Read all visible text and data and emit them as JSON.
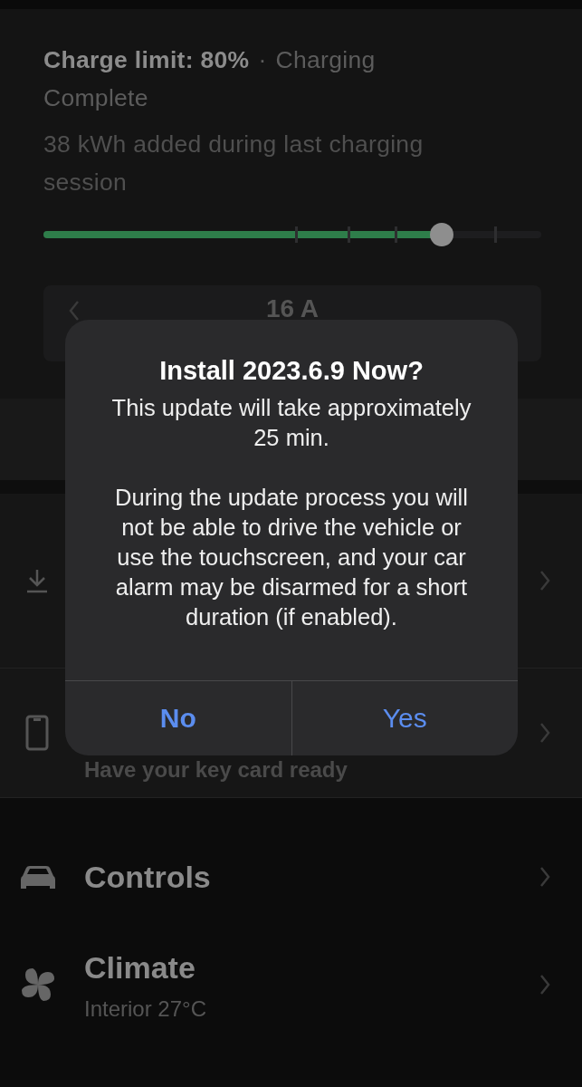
{
  "charge": {
    "limit": "Charge limit: 80%",
    "separator": "·",
    "status": "Charging Complete",
    "added": "38 kWh added during last charging session",
    "level": 0.8
  },
  "amperage": {
    "value": "16 A"
  },
  "rows": [
    {
      "kind": "download"
    },
    {
      "kind": "phone",
      "subtitle": "Have your key card ready"
    }
  ],
  "menu": [
    {
      "kind": "car",
      "title": "Controls"
    },
    {
      "kind": "fan",
      "title": "Climate",
      "subtitle": "Interior 27°C"
    }
  ],
  "dialog": {
    "title": "Install 2023.6.9 Now?",
    "paragraphs": [
      "This update will take approximately 25 min.",
      "During the update process you will not be able to drive the vehicle or use the touchscreen, and your car alarm may be disarmed for a short duration (if enabled)."
    ],
    "buttons": [
      {
        "label": "No",
        "primary": true
      },
      {
        "label": "Yes",
        "primary": false
      }
    ]
  }
}
